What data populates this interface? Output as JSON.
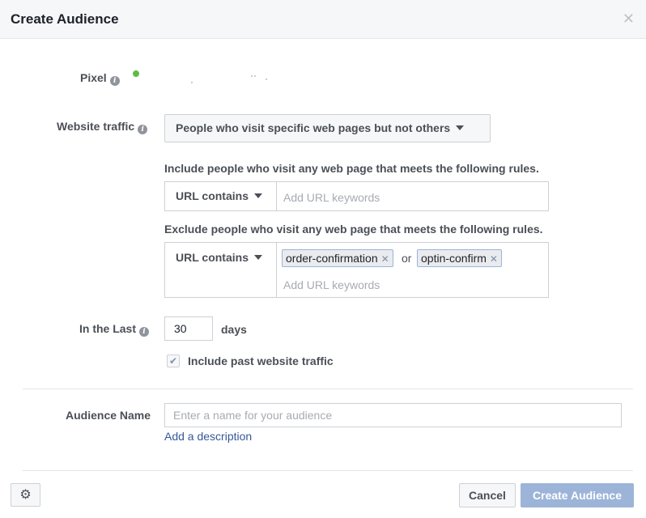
{
  "dialog": {
    "title": "Create Audience",
    "close_icon": "close-icon"
  },
  "pixel": {
    "label": "Pixel",
    "status_color": "#5fbb46"
  },
  "website_traffic": {
    "label": "Website traffic",
    "selected": "People who visit specific web pages but not others"
  },
  "include": {
    "text": "Include people who visit any web page that meets the following rules.",
    "condition": "URL contains",
    "placeholder": "Add URL keywords"
  },
  "exclude": {
    "text": "Exclude people who visit any web page that meets the following rules.",
    "condition": "URL contains",
    "tokens": [
      "order-confirmation",
      "optin-confirm"
    ],
    "joiner": "or",
    "placeholder": "Add URL keywords"
  },
  "in_the_last": {
    "label": "In the Last",
    "value": "30",
    "unit": "days"
  },
  "past_traffic": {
    "label": "Include past website traffic",
    "checked": true
  },
  "audience_name": {
    "label": "Audience Name",
    "placeholder": "Enter a name for your audience",
    "add_description": "Add a description"
  },
  "footer": {
    "settings_icon": "gear-icon",
    "cancel_label": "Cancel",
    "create_label": "Create Audience"
  },
  "colors": {
    "link": "#365899",
    "primary_disabled": "#9cb4d8"
  }
}
